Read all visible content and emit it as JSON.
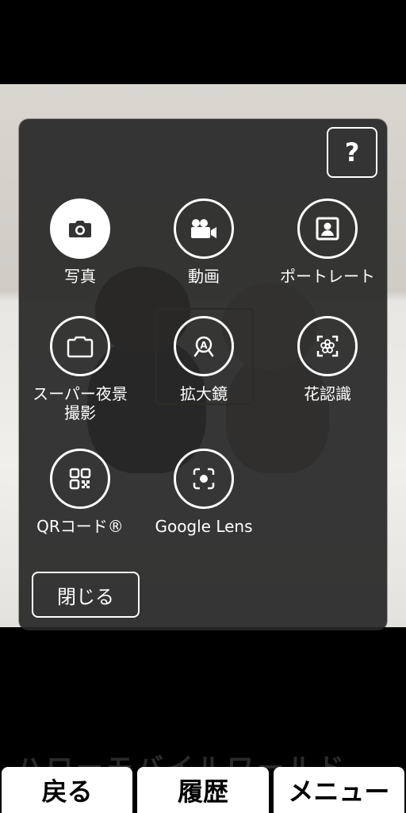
{
  "help": {
    "label": "?"
  },
  "modes": {
    "photo": {
      "label": "写真",
      "icon": "camera-icon",
      "active": true
    },
    "video": {
      "label": "動画",
      "icon": "video-camera-icon"
    },
    "portrait": {
      "label": "ポートレート",
      "icon": "portrait-icon"
    },
    "night": {
      "label": "スーパー夜景\n撮影",
      "icon": "night-mode-icon"
    },
    "magnifier": {
      "label": "拡大鏡",
      "icon": "magnifier-icon"
    },
    "flower": {
      "label": "花認識",
      "icon": "flower-recognition-icon"
    },
    "qr": {
      "label": "QRコード®",
      "icon": "qr-code-icon"
    },
    "lens": {
      "label": "Google Lens",
      "icon": "google-lens-icon"
    }
  },
  "close": {
    "label": "閉じる"
  },
  "watermark": {
    "text": "ハローモバイルワールド"
  },
  "nav": {
    "back": "戻る",
    "history": "履歴",
    "menu": "メニュー"
  }
}
